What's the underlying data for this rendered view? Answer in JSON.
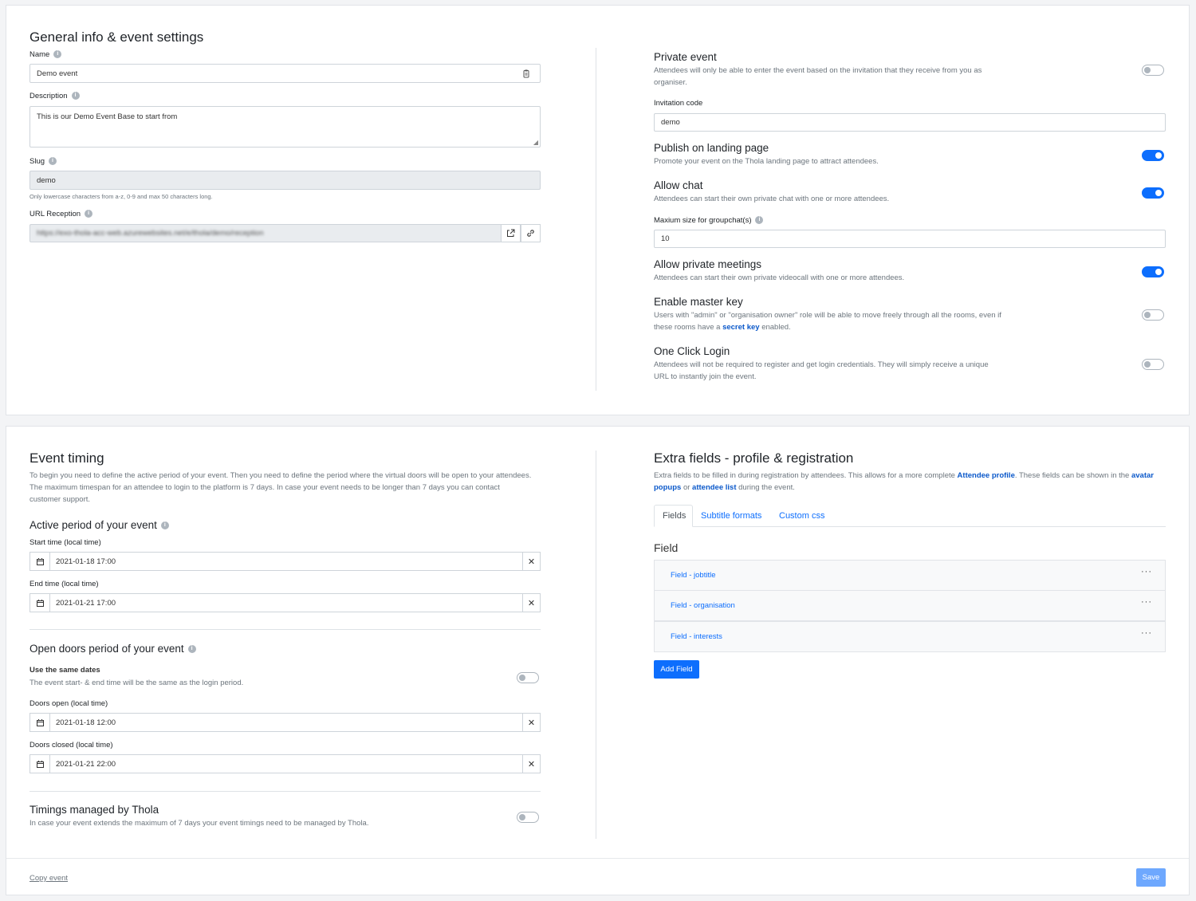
{
  "general": {
    "title": "General info & event settings",
    "name_label": "Name",
    "name_value": "Demo event",
    "description_label": "Description",
    "description_value": "This is our Demo Event Base to start from",
    "slug_label": "Slug",
    "slug_value": "demo",
    "slug_help": "Only lowercase characters from a-z, 0-9 and max 50 characters long.",
    "url_label": "URL Reception",
    "url_value": "https://exo-thola-acc-web.azurewebsites.net/e/thola/demo/reception"
  },
  "settings": {
    "private_title": "Private event",
    "private_desc": "Attendees will only be able to enter the event based on the invitation that they receive from you as organiser.",
    "private_on": false,
    "invitation_label": "Invitation code",
    "invitation_value": "demo",
    "publish_title": "Publish on landing page",
    "publish_desc": "Promote your event on the Thola landing page to attract attendees.",
    "publish_on": true,
    "chat_title": "Allow chat",
    "chat_desc": "Attendees can start their own private chat with one or more attendees.",
    "chat_on": true,
    "group_label": "Maxium size for groupchat(s)",
    "group_value": "10",
    "meetings_title": "Allow private meetings",
    "meetings_desc": "Attendees can start their own private videocall with one or more attendees.",
    "meetings_on": true,
    "master_title": "Enable master key",
    "master_desc_1": "Users with \"admin\" or \"organisation owner\" role will be able to move freely through all the rooms, even if these rooms have a",
    "master_link": "secret key",
    "master_desc_2": "enabled.",
    "master_on": false,
    "oneclick_title": "One Click Login",
    "oneclick_desc": "Attendees will not be required to register and get login credentials. They will simply receive a unique URL to instantly join the event.",
    "oneclick_on": false
  },
  "timing": {
    "title": "Event timing",
    "desc": "To begin you need to define the active period of your event. Then you need to define the period where the virtual doors will be open to your attendees. The maximum timespan for an attendee to login to the platform is 7 days. In case your event needs to be longer than 7 days you can contact customer support.",
    "active_title": "Active period of your event",
    "start_label": "Start time (local time)",
    "start_value": "2021-01-18 17:00",
    "end_label": "End time (local time)",
    "end_value": "2021-01-21 17:00",
    "doors_title": "Open doors period of your event",
    "same_title": "Use the same dates",
    "same_desc": "The event start- & end time will be the same as the login period.",
    "same_on": false,
    "open_label": "Doors open (local time)",
    "open_value": "2021-01-18 12:00",
    "closed_label": "Doors closed (local time)",
    "closed_value": "2021-01-21 22:00",
    "managed_title": "Timings managed by Thola",
    "managed_desc": "In case your event extends the maximum of 7 days your event timings need to be managed by Thola.",
    "managed_on": false
  },
  "extra": {
    "title": "Extra fields - profile & registration",
    "desc_1": "Extra fields to be filled in during registration by attendees. This allows for a more complete",
    "link_profile": "Attendee profile",
    "desc_2": ". These fields can be shown in the",
    "link_avatar": "avatar popups",
    "desc_3": "or",
    "link_list": "attendee list",
    "desc_4": "during the event.",
    "tabs": [
      "Fields",
      "Subtitle formats",
      "Custom css"
    ],
    "field_heading": "Field",
    "fields": [
      "Field - jobtitle",
      "Field - organisation",
      "Field - interests"
    ],
    "add_button": "Add Field"
  },
  "footer": {
    "copy_label": "Copy event",
    "save_label": "Save"
  },
  "colors": {
    "primary": "#0d6efd",
    "save_disabled": "#6ea8fe"
  }
}
